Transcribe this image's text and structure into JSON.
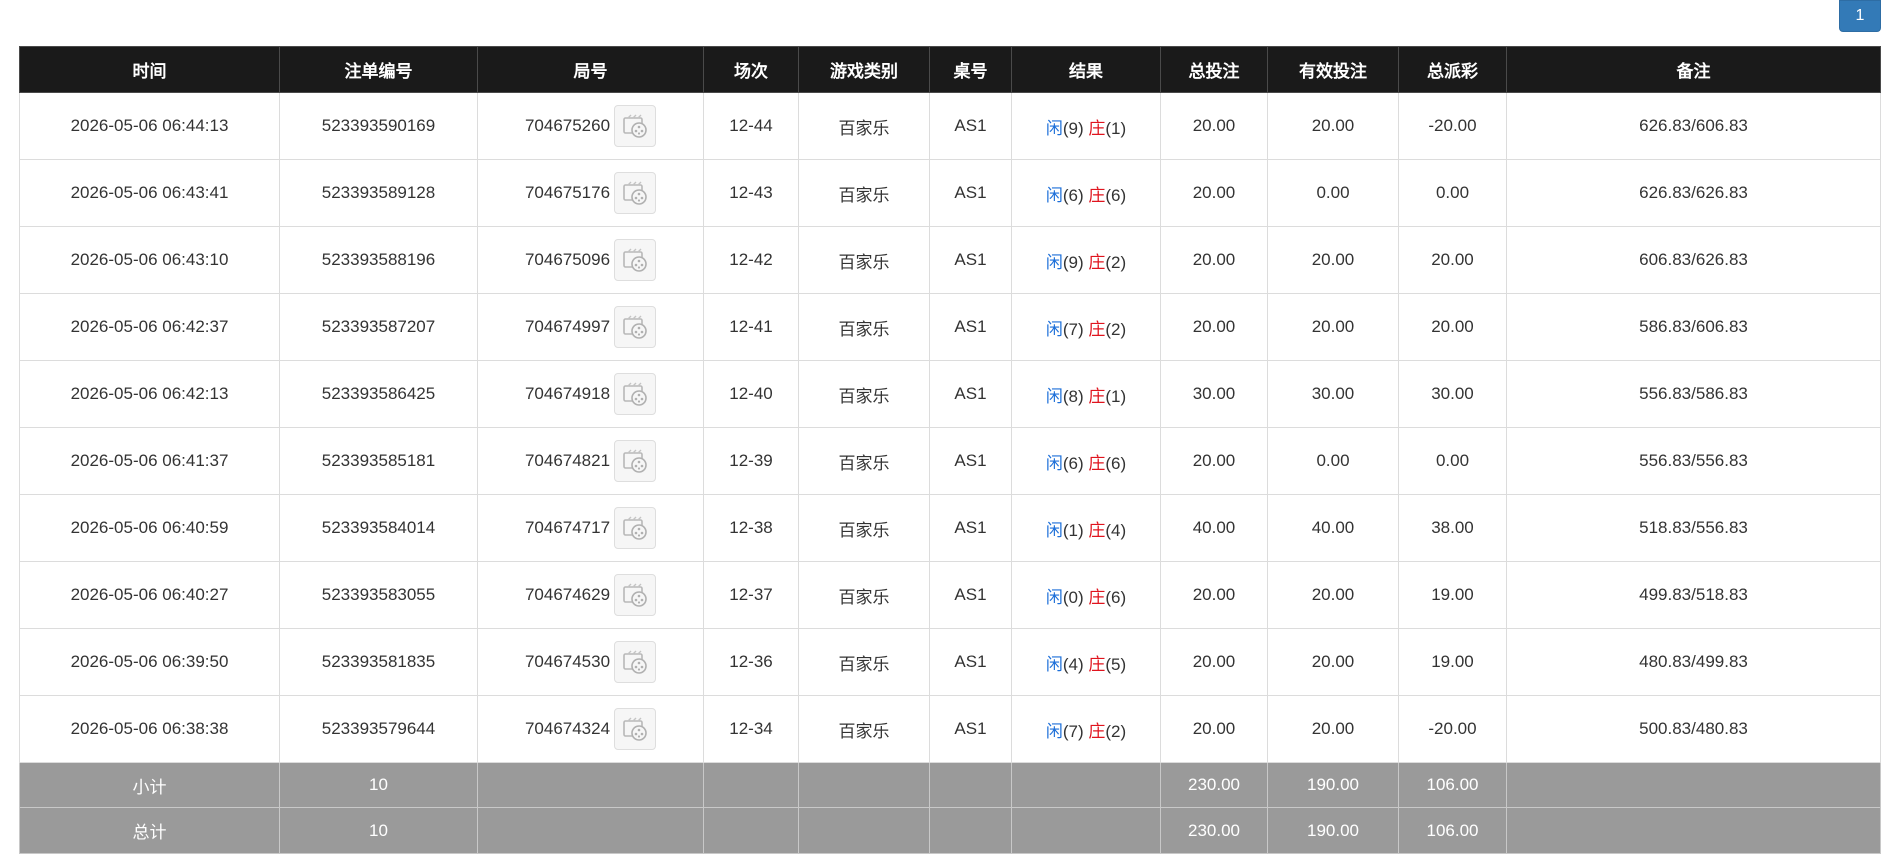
{
  "pagination": {
    "current_page": "1"
  },
  "columns": [
    "时间",
    "注单编号",
    "局号",
    "场次",
    "游戏类别",
    "桌号",
    "结果",
    "总投注",
    "有效投注",
    "总派彩",
    "备注"
  ],
  "rows": [
    {
      "time": "2026-05-06 06:44:13",
      "bet_id": "523393590169",
      "round": "704675260",
      "session": "12-44",
      "game": "百家乐",
      "table": "AS1",
      "player_label": "闲",
      "player_val": "(9)",
      "banker_label": "庄",
      "banker_val": "(1)",
      "total_bet": "20.00",
      "valid_bet": "20.00",
      "payout": "-20.00",
      "payout_color": "red",
      "note": "626.83/606.83"
    },
    {
      "time": "2026-05-06 06:43:41",
      "bet_id": "523393589128",
      "round": "704675176",
      "session": "12-43",
      "game": "百家乐",
      "table": "AS1",
      "player_label": "闲",
      "player_val": "(6)",
      "banker_label": "庄",
      "banker_val": "(6)",
      "total_bet": "20.00",
      "valid_bet": "0.00",
      "payout": "0.00",
      "payout_color": "default",
      "note": "626.83/626.83"
    },
    {
      "time": "2026-05-06 06:43:10",
      "bet_id": "523393588196",
      "round": "704675096",
      "session": "12-42",
      "game": "百家乐",
      "table": "AS1",
      "player_label": "闲",
      "player_val": "(9)",
      "banker_label": "庄",
      "banker_val": "(2)",
      "total_bet": "20.00",
      "valid_bet": "20.00",
      "payout": "20.00",
      "payout_color": "default",
      "note": "606.83/626.83"
    },
    {
      "time": "2026-05-06 06:42:37",
      "bet_id": "523393587207",
      "round": "704674997",
      "session": "12-41",
      "game": "百家乐",
      "table": "AS1",
      "player_label": "闲",
      "player_val": "(7)",
      "banker_label": "庄",
      "banker_val": "(2)",
      "total_bet": "20.00",
      "valid_bet": "20.00",
      "payout": "20.00",
      "payout_color": "default",
      "note": "586.83/606.83"
    },
    {
      "time": "2026-05-06 06:42:13",
      "bet_id": "523393586425",
      "round": "704674918",
      "session": "12-40",
      "game": "百家乐",
      "table": "AS1",
      "player_label": "闲",
      "player_val": "(8)",
      "banker_label": "庄",
      "banker_val": "(1)",
      "total_bet": "30.00",
      "valid_bet": "30.00",
      "payout": "30.00",
      "payout_color": "default",
      "note": "556.83/586.83"
    },
    {
      "time": "2026-05-06 06:41:37",
      "bet_id": "523393585181",
      "round": "704674821",
      "session": "12-39",
      "game": "百家乐",
      "table": "AS1",
      "player_label": "闲",
      "player_val": "(6)",
      "banker_label": "庄",
      "banker_val": "(6)",
      "total_bet": "20.00",
      "valid_bet": "0.00",
      "payout": "0.00",
      "payout_color": "default",
      "note": "556.83/556.83"
    },
    {
      "time": "2026-05-06 06:40:59",
      "bet_id": "523393584014",
      "round": "704674717",
      "session": "12-38",
      "game": "百家乐",
      "table": "AS1",
      "player_label": "闲",
      "player_val": "(1)",
      "banker_label": "庄",
      "banker_val": "(4)",
      "total_bet": "40.00",
      "valid_bet": "40.00",
      "payout": "38.00",
      "payout_color": "default",
      "note": "518.83/556.83"
    },
    {
      "time": "2026-05-06 06:40:27",
      "bet_id": "523393583055",
      "round": "704674629",
      "session": "12-37",
      "game": "百家乐",
      "table": "AS1",
      "player_label": "闲",
      "player_val": "(0)",
      "banker_label": "庄",
      "banker_val": "(6)",
      "total_bet": "20.00",
      "valid_bet": "20.00",
      "payout": "19.00",
      "payout_color": "default",
      "note": "499.83/518.83"
    },
    {
      "time": "2026-05-06 06:39:50",
      "bet_id": "523393581835",
      "round": "704674530",
      "session": "12-36",
      "game": "百家乐",
      "table": "AS1",
      "player_label": "闲",
      "player_val": "(4)",
      "banker_label": "庄",
      "banker_val": "(5)",
      "total_bet": "20.00",
      "valid_bet": "20.00",
      "payout": "19.00",
      "payout_color": "default",
      "note": "480.83/499.83"
    },
    {
      "time": "2026-05-06 06:38:38",
      "bet_id": "523393579644",
      "round": "704674324",
      "session": "12-34",
      "game": "百家乐",
      "table": "AS1",
      "player_label": "闲",
      "player_val": "(7)",
      "banker_label": "庄",
      "banker_val": "(2)",
      "total_bet": "20.00",
      "valid_bet": "20.00",
      "payout": "-20.00",
      "payout_color": "red",
      "note": "500.83/480.83"
    }
  ],
  "subtotal": {
    "label": "小计",
    "count": "10",
    "total_bet": "230.00",
    "valid_bet": "190.00",
    "payout": "106.00"
  },
  "grand_total": {
    "label": "总计",
    "count": "10",
    "total_bet": "230.00",
    "valid_bet": "190.00",
    "payout": "106.00"
  },
  "icons": {
    "replay": "video-replay-icon"
  },
  "colors": {
    "header_bg": "#1a1a1a",
    "summary_bg": "#9a9a9a",
    "blue": "#1c6fd9",
    "red": "#e0141e",
    "pager": "#337ab7"
  }
}
